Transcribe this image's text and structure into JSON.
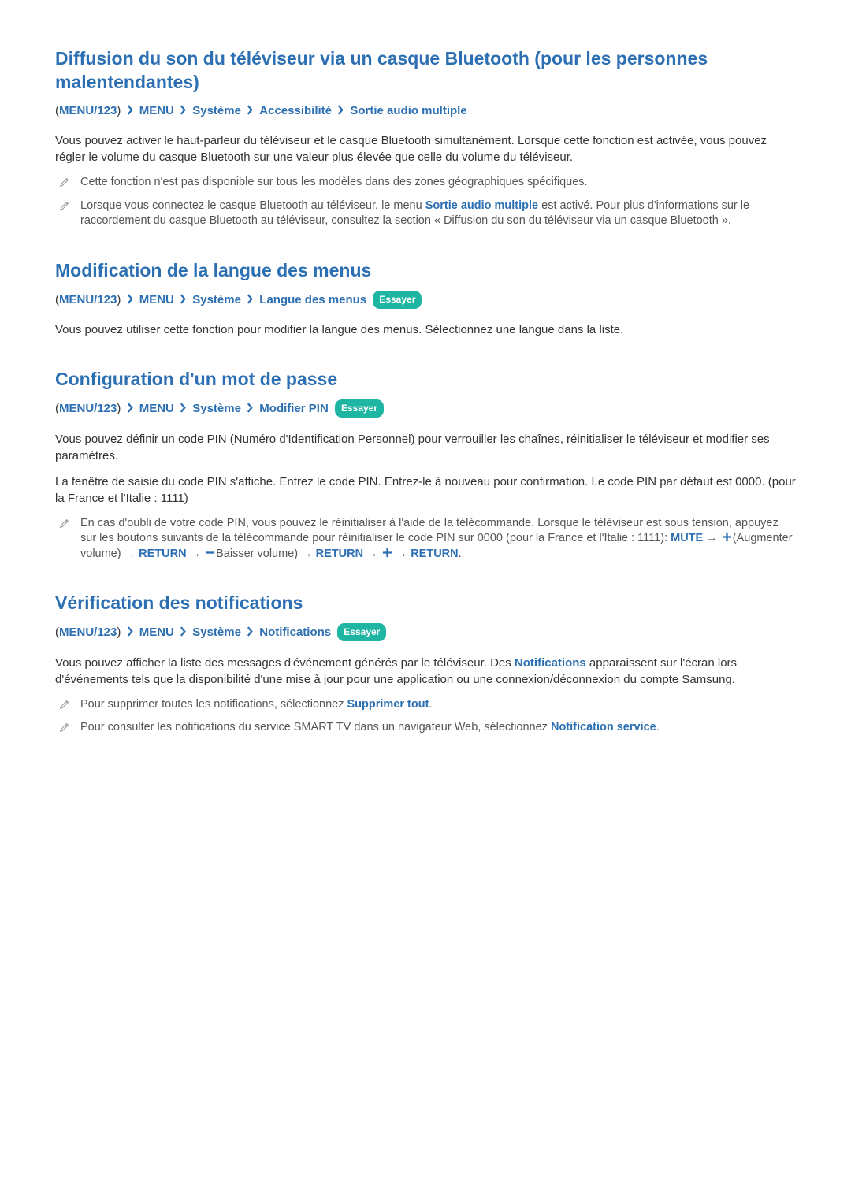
{
  "common": {
    "essayer_label": "Essayer",
    "breadcrumb_root": "MENU/123",
    "breadcrumb_menu": "MENU",
    "breadcrumb_system": "Système"
  },
  "sections": {
    "s1": {
      "title": "Diffusion du son du téléviseur via un casque Bluetooth (pour les personnes malentendantes)",
      "bc4": "Accessibilité",
      "bc5": "Sortie audio multiple",
      "body1": "Vous pouvez activer le haut-parleur du téléviseur et le casque Bluetooth simultanément. Lorsque cette fonction est activée, vous pouvez régler le volume du casque Bluetooth sur une valeur plus élevée que celle du volume du téléviseur.",
      "note1": "Cette fonction n'est pas disponible sur tous les modèles dans des zones géographiques spécifiques.",
      "note2_a": "Lorsque vous connectez le casque Bluetooth au téléviseur, le menu ",
      "note2_b": "Sortie audio multiple",
      "note2_c": " est activé. Pour plus d'informations sur le raccordement du casque Bluetooth au téléviseur, consultez la section « Diffusion du son du téléviseur via un casque Bluetooth »."
    },
    "s2": {
      "title": "Modification de la langue des menus",
      "bc4": "Langue des menus",
      "body1": "Vous pouvez utiliser cette fonction pour modifier la langue des menus. Sélectionnez une langue dans la liste."
    },
    "s3": {
      "title": "Configuration d'un mot de passe",
      "bc4": "Modifier PIN",
      "body1": "Vous pouvez définir un code PIN (Numéro d'Identification Personnel) pour verrouiller les chaînes, réinitialiser le téléviseur et modifier ses paramètres.",
      "body2": "La fenêtre de saisie du code PIN s'affiche. Entrez le code PIN. Entrez-le à nouveau pour confirmation. Le code PIN par défaut est 0000. (pour la France et l'Italie : 1111)",
      "note1_a": "En cas d'oubli de votre code PIN, vous pouvez le réinitialiser à l'aide de la télécommande. Lorsque le téléviseur est sous tension, appuyez sur les boutons suivants de la télécommande pour réinitialiser le code PIN sur 0000 (pour la France et l'Italie : 1111): ",
      "note1_mute": "MUTE",
      "note1_aug": "(Augmenter volume)",
      "note1_return": "RETURN",
      "note1_bai": "Baisser volume)"
    },
    "s4": {
      "title": "Vérification des notifications",
      "bc4": "Notifications",
      "body1_a": "Vous pouvez afficher la liste des messages d'événement générés par le téléviseur. Des ",
      "body1_b": "Notifications",
      "body1_c": " apparaissent sur l'écran lors d'événements tels que la disponibilité d'une mise à jour pour une application ou une connexion/déconnexion du compte Samsung.",
      "note1_a": "Pour supprimer toutes les notifications, sélectionnez ",
      "note1_b": "Supprimer tout",
      "note1_c": ".",
      "note2_a": "Pour consulter les notifications du service SMART TV dans un navigateur Web, sélectionnez ",
      "note2_b": "Notification service",
      "note2_c": "."
    }
  }
}
